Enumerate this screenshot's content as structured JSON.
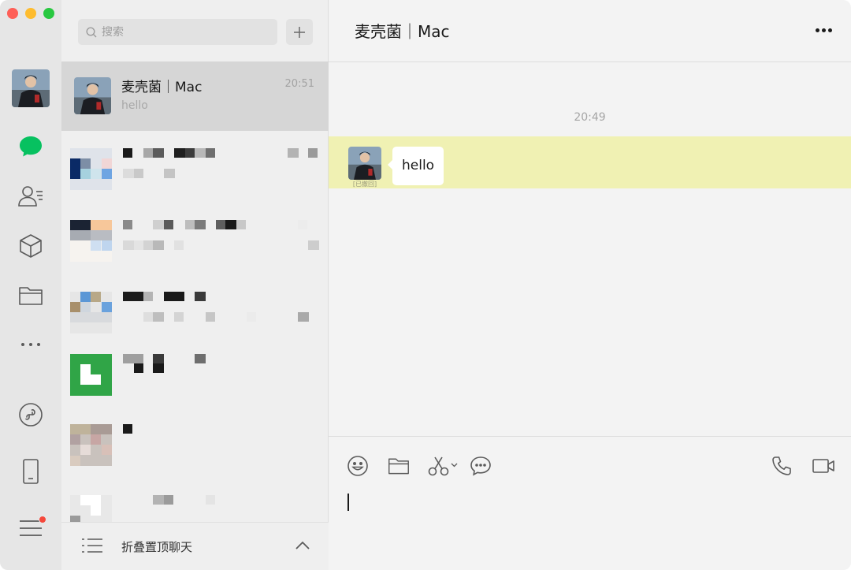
{
  "app": {
    "window_controls": [
      "close",
      "minimize",
      "zoom"
    ]
  },
  "rail": {
    "items": [
      {
        "name": "chats",
        "icon": "chat-bubble-icon",
        "active": true
      },
      {
        "name": "contacts",
        "icon": "contacts-icon"
      },
      {
        "name": "favorites",
        "icon": "cube-icon"
      },
      {
        "name": "files",
        "icon": "folder-icon"
      },
      {
        "name": "more",
        "icon": "more-horizontal-icon"
      },
      {
        "name": "mini-programs",
        "icon": "mini-program-icon"
      },
      {
        "name": "phone",
        "icon": "phone-device-icon"
      },
      {
        "name": "menu",
        "icon": "hamburger-menu-icon",
        "badge": true
      }
    ],
    "accent_color": "#07c160",
    "badge_color": "#f5483b"
  },
  "search": {
    "placeholder": "搜索"
  },
  "chat_list": {
    "active": {
      "name": "麦壳菌｜Mac",
      "time": "20:51",
      "preview": "hello"
    },
    "footer": {
      "label": "折叠置顶聊天"
    }
  },
  "conversation": {
    "title": "麦壳菌｜Mac",
    "time_separator": "20:49",
    "messages": [
      {
        "text": "hello",
        "status": "[已撤回]",
        "highlight_color": "#f0f1b3"
      }
    ],
    "composer_tools": [
      "emoji-icon",
      "folder-icon",
      "scissors-icon",
      "chat-history-icon",
      "voice-call-icon",
      "video-call-icon"
    ]
  }
}
